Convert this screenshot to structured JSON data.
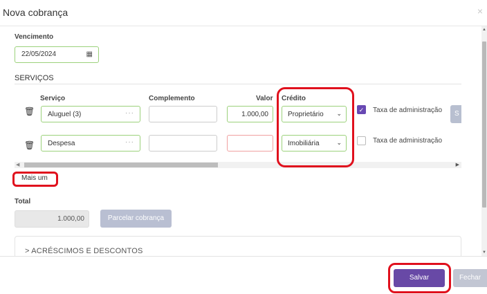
{
  "modal": {
    "title": "Nova cobrança",
    "close_glyph": "×"
  },
  "vencimento": {
    "label": "Vencimento",
    "value": "22/05/2024",
    "icon": "calendar-icon"
  },
  "servicos": {
    "title": "SERVIÇOS",
    "columns": {
      "servico": "Serviço",
      "complemento": "Complemento",
      "valor": "Valor",
      "credito": "Crédito"
    },
    "rows": [
      {
        "servico": "Aluguel (3)",
        "complemento": "",
        "valor": "1.000,00",
        "credito": "Proprietário",
        "taxa_label": "Taxa de administração",
        "taxa_checked": true,
        "extra_button": "S"
      },
      {
        "servico": "Despesa",
        "complemento": "",
        "valor": "",
        "credito": "Imobiliária",
        "taxa_label": "Taxa de administração",
        "taxa_checked": false
      }
    ],
    "mais_um": "Mais um"
  },
  "total": {
    "label": "Total",
    "value": "1.000,00",
    "parcelar_label": "Parcelar cobrança"
  },
  "panel": {
    "title": "> ACRÉSCIMOS E DESCONTOS"
  },
  "footer": {
    "save_label": "Salvar",
    "close_label": "Fechar"
  },
  "colors": {
    "accent": "#6849a6",
    "input_border_ok": "#9bd17a",
    "input_border_error": "#f0a0a0",
    "annotation": "#e0101d"
  }
}
